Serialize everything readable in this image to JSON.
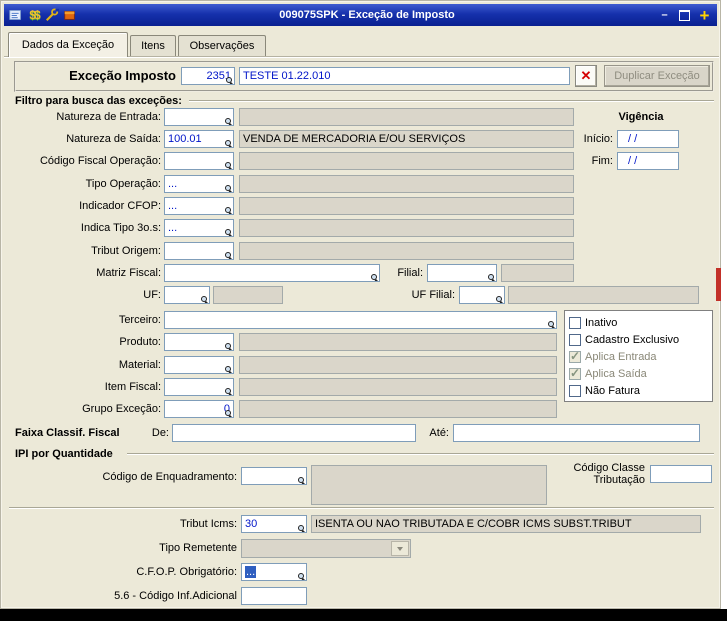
{
  "titlebar": {
    "title": "009075SPK - Exceção de Imposto",
    "money_glyph": "$$",
    "minimize_glyph": "–",
    "close_glyph": "+"
  },
  "tabs": {
    "dados": "Dados da Exceção",
    "itens": "Itens",
    "observacoes": "Observações"
  },
  "header": {
    "label": "Exceção Imposto",
    "code": "2351",
    "description": "TESTE 01.22.010",
    "delete_glyph": "✕",
    "duplicate_label": "Duplicar Exceção"
  },
  "filter": {
    "title": "Filtro para busca das exceções:",
    "natureza_entrada": {
      "label": "Natureza de Entrada:",
      "value": "",
      "desc": ""
    },
    "natureza_saida": {
      "label": "Natureza de Saída:",
      "value": "100.01",
      "desc": "VENDA DE MERCADORIA E/OU SERVIÇOS"
    },
    "codigo_fiscal": {
      "label": "Código Fiscal Operação:",
      "value": "",
      "desc": ""
    },
    "tipo_operacao": {
      "label": "Tipo Operação:",
      "value": "...",
      "desc": ""
    },
    "indicador_cfop": {
      "label": "Indicador CFOP:",
      "value": "...",
      "desc": ""
    },
    "indica_tipo_3os": {
      "label": "Indica Tipo 3o.s:",
      "value": "...",
      "desc": ""
    },
    "tribut_origem": {
      "label": "Tribut Origem:",
      "value": "",
      "desc": ""
    },
    "matriz_fiscal": {
      "label": "Matriz Fiscal:",
      "value": ""
    },
    "filial": {
      "label": "Filial:",
      "value": "",
      "desc": ""
    },
    "uf": {
      "label": "UF:",
      "value": "",
      "desc": ""
    },
    "uf_filial": {
      "label": "UF Filial:",
      "value": "",
      "desc": ""
    },
    "terceiro": {
      "label": "Terceiro:",
      "value": ""
    },
    "produto": {
      "label": "Produto:",
      "value": "",
      "desc": ""
    },
    "material": {
      "label": "Material:",
      "value": "",
      "desc": ""
    },
    "item_fiscal": {
      "label": "Item Fiscal:",
      "value": "",
      "desc": ""
    },
    "grupo_excecao": {
      "label": "Grupo Exceção:",
      "value": "0",
      "desc": ""
    }
  },
  "vigencia": {
    "title": "Vigência",
    "inicio_label": "Início:",
    "inicio": "/  /",
    "fim_label": "Fim:",
    "fim": "/  /"
  },
  "checkboxes": [
    {
      "label": "Inativo",
      "checked": false,
      "disabled": false
    },
    {
      "label": "Cadastro Exclusivo",
      "checked": false,
      "disabled": false
    },
    {
      "label": "Aplica Entrada",
      "checked": true,
      "disabled": true
    },
    {
      "label": "Aplica Saída",
      "checked": true,
      "disabled": true
    },
    {
      "label": "Não Fatura",
      "checked": false,
      "disabled": false
    }
  ],
  "faixa": {
    "title": "Faixa Classif. Fiscal",
    "de_label": "De:",
    "de": "",
    "ate_label": "Até:",
    "ate": ""
  },
  "ipi": {
    "title": "IPI por Quantidade",
    "enquadramento_label": "Código de Enquadramento:",
    "enquadramento": "",
    "enquadramento_desc": "",
    "classe_label": "Código Classe Tributação",
    "classe": ""
  },
  "tributacao": {
    "tribut_icms_label": "Tribut Icms:",
    "tribut_icms": "30",
    "tribut_icms_desc": "ISENTA OU NAO TRIBUTADA E C/COBR ICMS SUBST.TRIBUT",
    "tipo_remetente_label": "Tipo Remetente",
    "tipo_remetente": "",
    "cfop_obrigatorio_label": "C.F.O.P. Obrigatório:",
    "cfop_obrigatorio": "...",
    "cod_inf_adicional_label": "5.6 - Código Inf.Adicional",
    "cod_inf_adicional": ""
  },
  "colors": {
    "titlebar_blue": "#1631ac",
    "field_text_blue": "#0014c8",
    "selection_blue": "#2f5fc0",
    "delete_red": "#d40000",
    "plus_yellow": "#ffd400",
    "edge_marker_red": "#c23028",
    "readonly_gray": "#dad6ca"
  }
}
